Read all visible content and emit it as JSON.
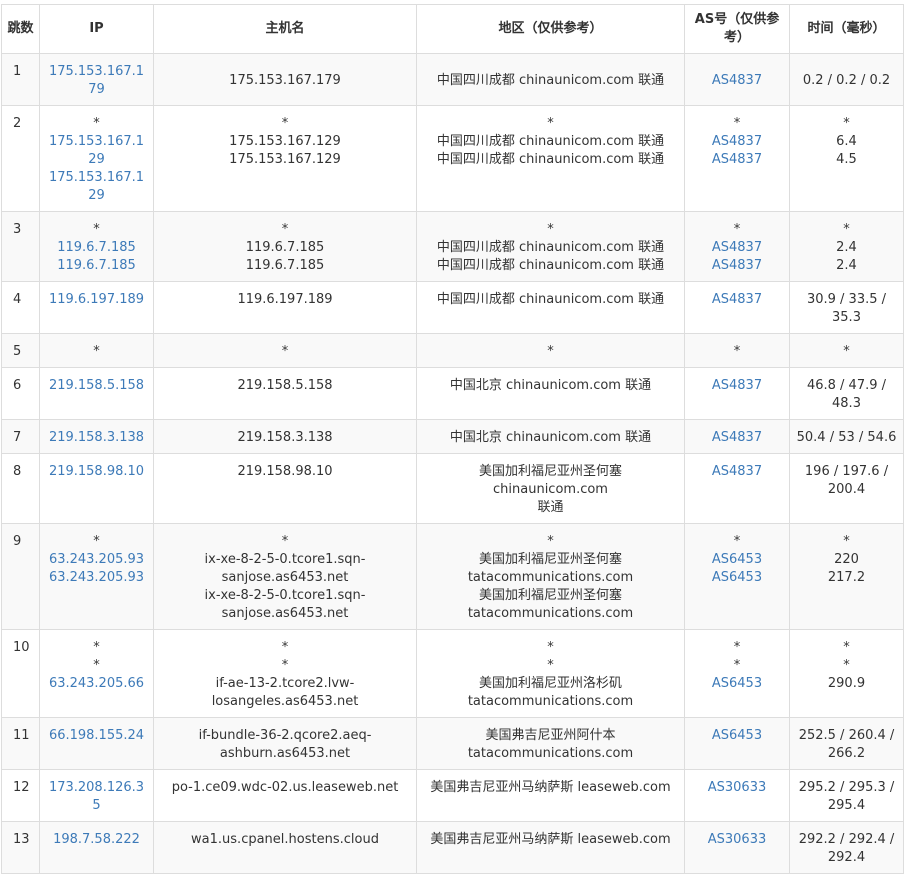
{
  "headers": [
    "跳数",
    "IP",
    "主机名",
    "地区（仅供参考）",
    "AS号（仅供参考）",
    "时间（毫秒）"
  ],
  "colors": {
    "link": "#3d7ab8",
    "text": "#333333",
    "border": "#dddddd",
    "stripe": "#f9f9f9"
  },
  "rows": [
    {
      "hop": "1",
      "ip": [
        "175.153.167.179"
      ],
      "host": [
        "175.153.167.179"
      ],
      "region": [
        "中国四川成都 chinaunicom.com 联通"
      ],
      "as": [
        "AS4837"
      ],
      "time": [
        "0.2 / 0.2 / 0.2"
      ]
    },
    {
      "hop": "2",
      "ip": [
        "*",
        "175.153.167.129",
        "175.153.167.129"
      ],
      "host": [
        "*",
        "175.153.167.129",
        "175.153.167.129"
      ],
      "region": [
        "*",
        "中国四川成都 chinaunicom.com 联通",
        "中国四川成都 chinaunicom.com 联通"
      ],
      "as": [
        "*",
        "AS4837",
        "AS4837"
      ],
      "time": [
        "*",
        "6.4",
        "4.5"
      ]
    },
    {
      "hop": "3",
      "ip": [
        "*",
        "119.6.7.185",
        "119.6.7.185"
      ],
      "host": [
        "*",
        "119.6.7.185",
        "119.6.7.185"
      ],
      "region": [
        "*",
        "中国四川成都 chinaunicom.com 联通",
        "中国四川成都 chinaunicom.com 联通"
      ],
      "as": [
        "*",
        "AS4837",
        "AS4837"
      ],
      "time": [
        "*",
        "2.4",
        "2.4"
      ]
    },
    {
      "hop": "4",
      "ip": [
        "119.6.197.189"
      ],
      "host": [
        "119.6.197.189"
      ],
      "region": [
        "中国四川成都 chinaunicom.com 联通"
      ],
      "as": [
        "AS4837"
      ],
      "time": [
        "30.9 / 33.5 /",
        "35.3"
      ]
    },
    {
      "hop": "5",
      "ip": [
        "*"
      ],
      "host": [
        "*"
      ],
      "region": [
        "*"
      ],
      "as": [
        "*"
      ],
      "time": [
        "*"
      ]
    },
    {
      "hop": "6",
      "ip": [
        "219.158.5.158"
      ],
      "host": [
        "219.158.5.158"
      ],
      "region": [
        "中国北京 chinaunicom.com 联通"
      ],
      "as": [
        "AS4837"
      ],
      "time": [
        "46.8 / 47.9 /",
        "48.3"
      ]
    },
    {
      "hop": "7",
      "ip": [
        "219.158.3.138"
      ],
      "host": [
        "219.158.3.138"
      ],
      "region": [
        "中国北京 chinaunicom.com 联通"
      ],
      "as": [
        "AS4837"
      ],
      "time": [
        "50.4 / 53 / 54.6"
      ]
    },
    {
      "hop": "8",
      "ip": [
        "219.158.98.10"
      ],
      "host": [
        "219.158.98.10"
      ],
      "region": [
        "美国加利福尼亚州圣何塞 chinaunicom.com",
        "联通"
      ],
      "as": [
        "AS4837"
      ],
      "time": [
        "196 / 197.6 /",
        "200.4"
      ]
    },
    {
      "hop": "9",
      "ip": [
        "*",
        "63.243.205.93",
        "63.243.205.93"
      ],
      "host": [
        "*",
        "ix-xe-8-2-5-0.tcore1.sqn-",
        "sanjose.as6453.net",
        "ix-xe-8-2-5-0.tcore1.sqn-",
        "sanjose.as6453.net"
      ],
      "region": [
        "*",
        "美国加利福尼亚州圣何塞",
        "tatacommunications.com",
        "美国加利福尼亚州圣何塞",
        "tatacommunications.com"
      ],
      "as": [
        "*",
        "AS6453",
        "AS6453"
      ],
      "time": [
        "*",
        "220",
        "217.2"
      ]
    },
    {
      "hop": "10",
      "ip": [
        "*",
        "*",
        "63.243.205.66"
      ],
      "host": [
        "*",
        "*",
        "if-ae-13-2.tcore2.lvw-",
        "losangeles.as6453.net"
      ],
      "region": [
        "*",
        "*",
        "美国加利福尼亚州洛杉矶",
        "tatacommunications.com"
      ],
      "as": [
        "*",
        "*",
        "AS6453"
      ],
      "time": [
        "*",
        "*",
        "290.9"
      ]
    },
    {
      "hop": "11",
      "ip": [
        "66.198.155.24"
      ],
      "host": [
        "if-bundle-36-2.qcore2.aeq-",
        "ashburn.as6453.net"
      ],
      "region": [
        "美国弗吉尼亚州阿什本",
        "tatacommunications.com"
      ],
      "as": [
        "AS6453"
      ],
      "time": [
        "252.5 / 260.4 /",
        "266.2"
      ]
    },
    {
      "hop": "12",
      "ip": [
        "173.208.126.35"
      ],
      "host": [
        "po-1.ce09.wdc-02.us.leaseweb.net"
      ],
      "region": [
        "美国弗吉尼亚州马纳萨斯 leaseweb.com"
      ],
      "as": [
        "AS30633"
      ],
      "time": [
        "295.2 / 295.3 /",
        "295.4"
      ]
    },
    {
      "hop": "13",
      "ip": [
        "198.7.58.222"
      ],
      "host": [
        "wa1.us.cpanel.hostens.cloud"
      ],
      "region": [
        "美国弗吉尼亚州马纳萨斯 leaseweb.com"
      ],
      "as": [
        "AS30633"
      ],
      "time": [
        "292.2 / 292.4 /",
        "292.4"
      ]
    }
  ]
}
